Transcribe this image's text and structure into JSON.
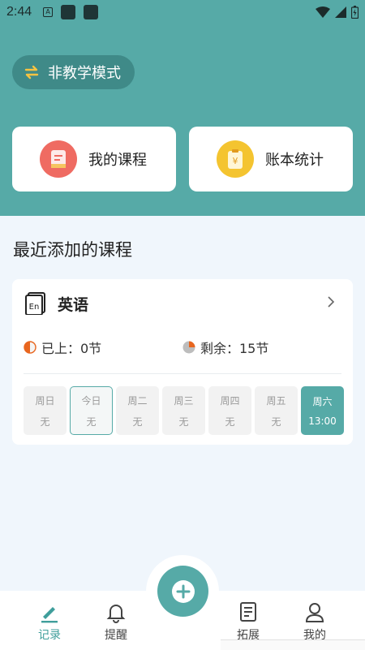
{
  "status_bar": {
    "time": "2:44",
    "a_badge": "A"
  },
  "mode": {
    "label": "非教学模式",
    "icon": "swap-icon"
  },
  "quick_cards": [
    {
      "label": "我的课程",
      "icon": "course-note-icon",
      "color": "#ef6b62"
    },
    {
      "label": "账本统计",
      "icon": "ledger-yen-icon",
      "color": "#f4c430"
    }
  ],
  "recent": {
    "title": "最近添加的课程",
    "course": {
      "name": "英语",
      "icon_text": "En",
      "done_label": "已上：0节",
      "left_label": "剩余：15节",
      "days": [
        {
          "name": "周日",
          "value": "无"
        },
        {
          "name": "今日",
          "value": "无"
        },
        {
          "name": "周二",
          "value": "无"
        },
        {
          "name": "周三",
          "value": "无"
        },
        {
          "name": "周四",
          "value": "无"
        },
        {
          "name": "周五",
          "value": "无"
        },
        {
          "name": "周六",
          "value": "13:00"
        }
      ]
    }
  },
  "tabs": [
    {
      "label": "记录",
      "icon": "pen-record-icon"
    },
    {
      "label": "提醒",
      "icon": "bell-icon"
    },
    {
      "label": "拓展",
      "icon": "document-icon"
    },
    {
      "label": "我的",
      "icon": "user-icon"
    }
  ],
  "colors": {
    "primary": "#56aaa7",
    "primary_dark": "#3f8a88",
    "background": "#f0f6fc"
  }
}
